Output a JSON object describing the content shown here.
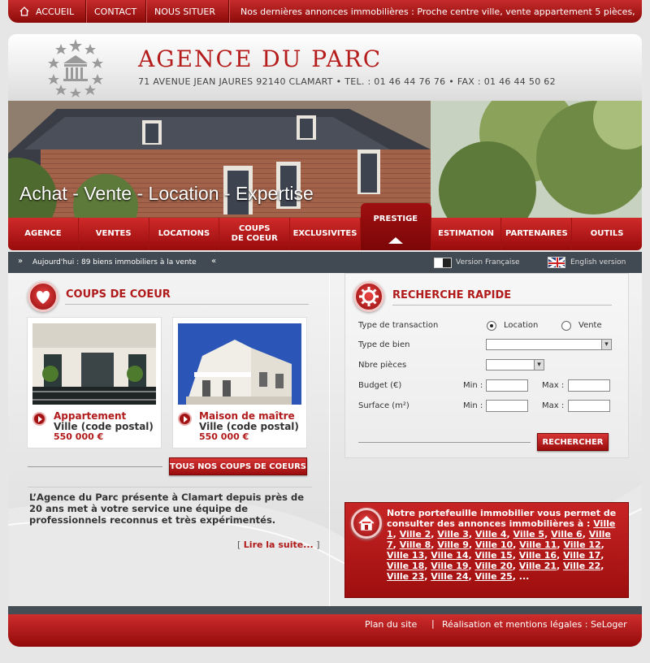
{
  "topnav": {
    "home": "ACCUEIL",
    "contact": "CONTACT",
    "locate": "NOUS SITUER",
    "ticker": "Nos dernières annonces immobilières : Proche centre ville, vente appartement 5 pièces,"
  },
  "header": {
    "brand": "AGENCE DU PARC",
    "address": "71 AVENUE JEAN JAURES 92140 CLAMART • TEL. : 01 46 44 76 76 • FAX : 01 46 44 50 62",
    "slogan": "Achat - Vente - Location - Expertise"
  },
  "mainnav": [
    {
      "label": "AGENCE"
    },
    {
      "label": "VENTES"
    },
    {
      "label": "LOCATIONS"
    },
    {
      "label": "COUPS\nDE COEUR"
    },
    {
      "label": "EXCLUSIVITES"
    },
    {
      "label": "PRESTIGE"
    },
    {
      "label": "ESTIMATION"
    },
    {
      "label": "PARTENAIRES"
    },
    {
      "label": "OUTILS"
    }
  ],
  "infobar": {
    "today": "Aujourd'hui : 89 biens immobiliers à la vente",
    "lang_fr": "Version Française",
    "lang_en": "English version"
  },
  "coups": {
    "title": "COUPS DE COEUR",
    "cards": [
      {
        "type": "Appartement",
        "city": "Ville (code postal)",
        "price": "550 000 €"
      },
      {
        "type": "Maison de maître",
        "city": "Ville (code postal)",
        "price": "550 000 €"
      }
    ],
    "all_button": "TOUS NOS COUPS DE COEURS",
    "intro": "L’Agence du Parc présente à Clamart depuis près de 20 ans met à votre service une équipe de professionnels reconnus et très expérimentés.",
    "read_more": "Lire la suite..."
  },
  "search": {
    "title": "RECHERCHE RAPIDE",
    "transaction_label": "Type de transaction",
    "opt_location": "Location",
    "opt_vente": "Vente",
    "selected": "Location",
    "bien_label": "Type de bien",
    "pieces_label": "Nbre pièces",
    "budget_label": "Budget (€)",
    "surface_label": "Surface (m²)",
    "min": "Min :",
    "max": "Max :",
    "submit": "RECHERCHER"
  },
  "portfolio": {
    "intro": "Notre portefeuille immobilier vous permet de consulter des annonces immobilières à :",
    "cities": [
      "Ville 1",
      "Ville 2",
      "Ville 3",
      "Ville 4",
      "Ville 5",
      "Ville 6",
      "Ville 7",
      "Ville 8",
      "Ville 9",
      "Ville 10",
      "Ville 11",
      "Ville 12",
      "Ville 13",
      "Ville 14",
      "Ville 15",
      "Ville 16",
      "Ville 17",
      "Ville 18",
      "Ville 19",
      "Ville 20",
      "Ville 21",
      "Ville 22",
      "Ville 23",
      "Ville 24",
      "Ville 25"
    ],
    "ellipsis": "..."
  },
  "footer": {
    "sitemap": "Plan du site",
    "legal": "Réalisation et mentions légales : SeLoger"
  },
  "colors": {
    "brand_red": "#b51d1d",
    "nav_red": "#c62b2b",
    "dark_bar": "#414a52"
  }
}
